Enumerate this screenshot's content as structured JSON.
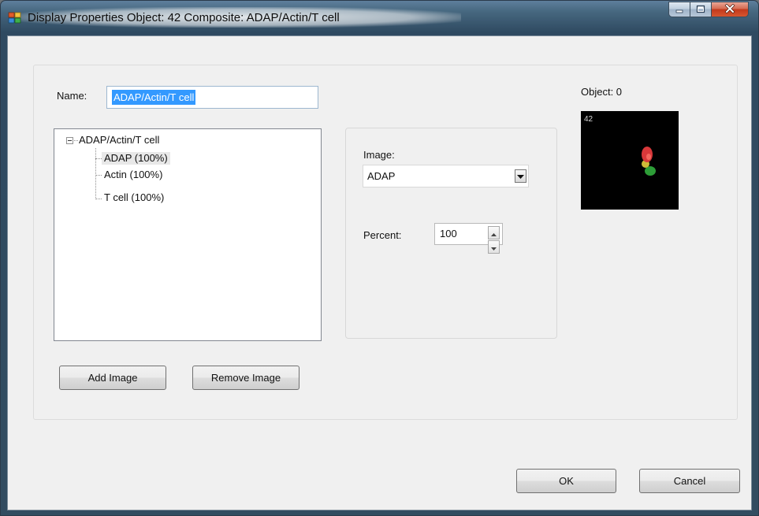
{
  "window": {
    "title": "Display Properties  Object: 42 Composite: ADAP/Actin/T cell",
    "icon": "app-window-icon",
    "caption_buttons": [
      "minimize-icon",
      "maximize-icon",
      "close-icon"
    ]
  },
  "name": {
    "label": "Name:",
    "value": "ADAP/Actin/T cell"
  },
  "tree": {
    "root": "ADAP/Actin/T cell",
    "items": [
      {
        "label": "ADAP (100%)",
        "selected": true
      },
      {
        "label": "Actin (100%)",
        "selected": false
      },
      {
        "label": "T cell (100%)",
        "selected": false
      }
    ]
  },
  "image": {
    "label": "Image:",
    "selected": "ADAP"
  },
  "percent": {
    "label": "Percent:",
    "value": "100"
  },
  "object": {
    "label": "Object: 0",
    "thumbnail_label": "42"
  },
  "buttons": {
    "add_image": "Add Image",
    "remove_image": "Remove Image",
    "ok": "OK",
    "cancel": "Cancel"
  },
  "colors": {
    "selection": "#3399ff",
    "thumbnail_bg": "#000000",
    "cell_red": "#d8383a",
    "cell_green": "#2fa53a",
    "cell_yellow": "#d9c43b"
  }
}
